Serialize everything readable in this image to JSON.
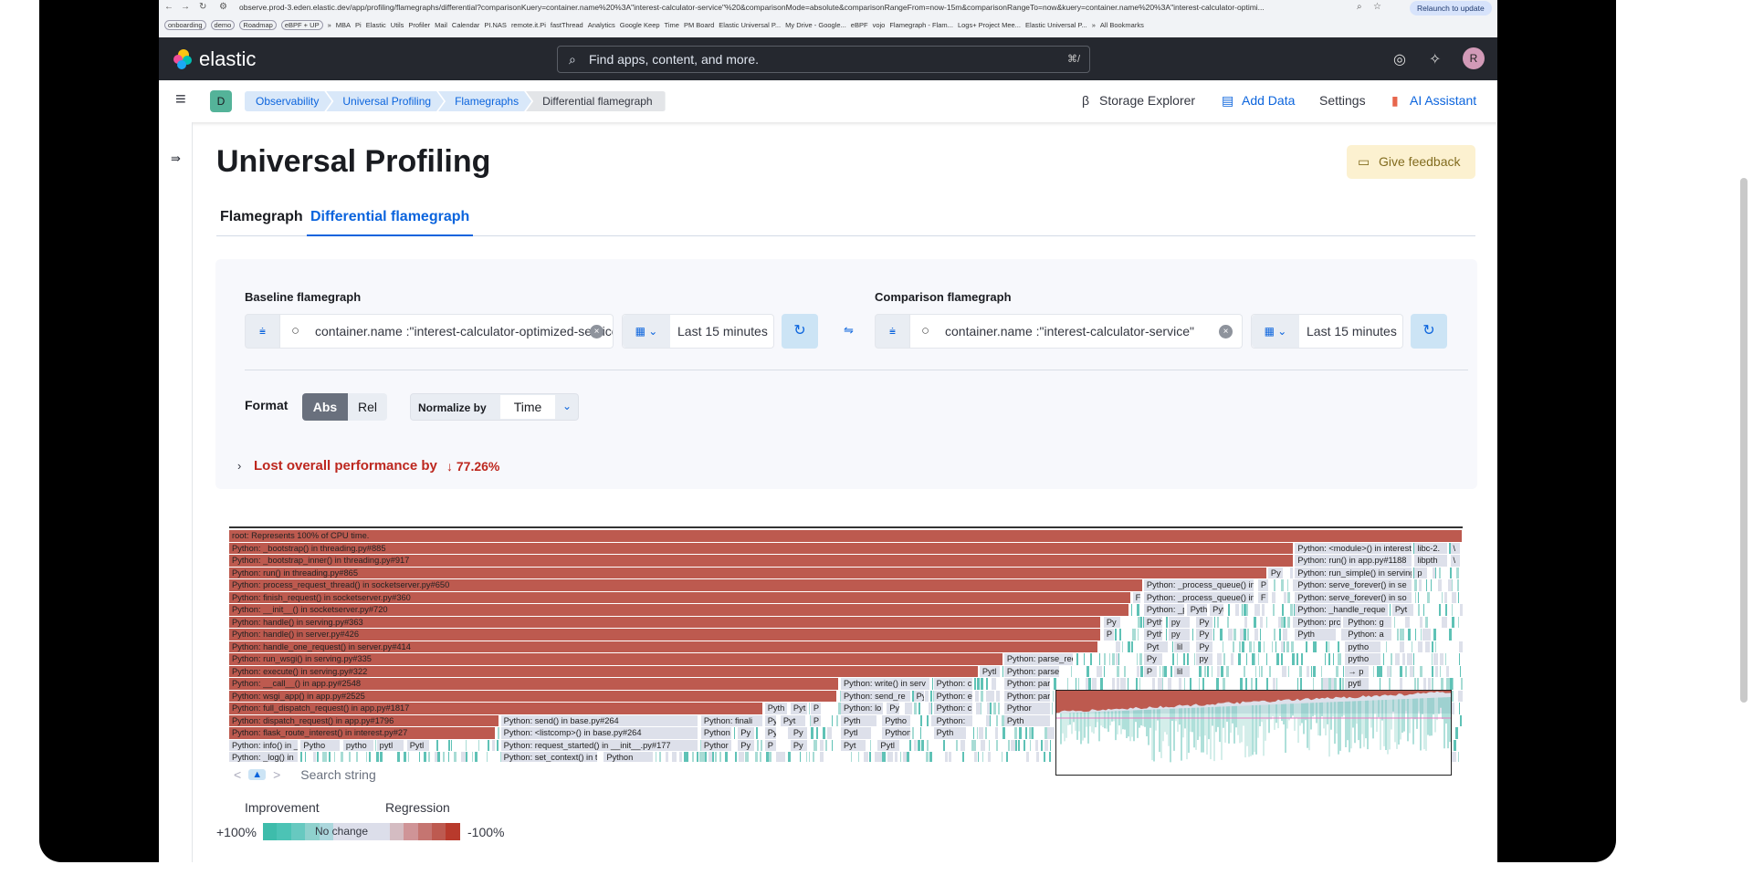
{
  "browser": {
    "url": "observe.prod-3.eden.elastic.dev/app/profiling/flamegraphs/differential?comparisonKuery=container.name%20%3A\"interest-calculator-service\"%20&comparisonMode=absolute&comparisonRangeFrom=now-15m&comparisonRangeTo=now&kuery=container.name%20%3A\"interest-calculator-optimi...",
    "relaunch": "Relaunch to update",
    "bookmarks": [
      "onboarding",
      "demo",
      "Roadmap",
      "eBPF + UP",
      "»",
      "MBA",
      "Pi",
      "Elastic",
      "Utils",
      "Profiler",
      "Mail",
      "Calendar",
      "PI.NAS",
      "remote.it.Pi",
      "fastThread",
      "Analytics",
      "Google Keep",
      "Time",
      "PM Board",
      "Elastic Universal P...",
      "My Drive - Google...",
      "eBPF",
      "vojo",
      "Flamegraph - Flam...",
      "Logs+ Project Mee...",
      "Elastic Universal P...",
      "»",
      "All Bookmarks"
    ]
  },
  "header": {
    "brand": "elastic",
    "search_placeholder": "Find apps, content, and more.",
    "shortcut": "⌘/",
    "avatar": "R"
  },
  "breadcrumbs": {
    "space": "D",
    "items": [
      "Observability",
      "Universal Profiling",
      "Flamegraphs",
      "Differential flamegraph"
    ]
  },
  "topnav": {
    "beta": "β",
    "storage": "Storage Explorer",
    "add_data": "Add Data",
    "settings": "Settings",
    "ai": "AI Assistant"
  },
  "page": {
    "title": "Universal Profiling",
    "feedback": "Give feedback",
    "tabs": [
      "Flamegraph",
      "Differential flamegraph"
    ],
    "active_tab": 1
  },
  "baseline": {
    "label": "Baseline flamegraph",
    "query": "container.name :\"interest-calculator-optimized-service\"",
    "time": "Last 15 minutes"
  },
  "comparison": {
    "label": "Comparison flamegraph",
    "query": "container.name :\"interest-calculator-service\"",
    "time": "Last 15 minutes"
  },
  "format": {
    "label": "Format",
    "options": [
      "Abs",
      "Rel"
    ],
    "selected": "Abs",
    "normalize_label": "Normalize by",
    "normalize_value": "Time"
  },
  "summary": {
    "text": "Lost overall performance by",
    "value": "↓ 77.26%",
    "color": "#bd271e"
  },
  "flamegraph": {
    "rows": [
      [
        {
          "l": "root: Represents 100% of CPU time.",
          "k": "r"
        }
      ],
      [
        {
          "l": "Python: _bootstrap() in threading.py#885",
          "k": "r"
        },
        {
          "l": "Python: <module>() in interest.py",
          "k": "n"
        },
        {
          "l": "libc-2.",
          "k": "n"
        },
        {
          "l": "\\",
          "k": "n"
        }
      ],
      [
        {
          "l": "Python: _bootstrap_inner() in threading.py#917",
          "k": "r"
        },
        {
          "l": "Python: run() in app.py#1188",
          "k": "n"
        },
        {
          "l": "libpth",
          "k": "n"
        },
        {
          "l": "\\",
          "k": "n"
        }
      ],
      [
        {
          "l": "Python: run() in threading.py#865",
          "k": "r"
        },
        {
          "l": "Py",
          "k": "n"
        },
        {
          "l": "Python: run_simple() in serving",
          "k": "n"
        },
        {
          "l": "p",
          "k": "n"
        }
      ],
      [
        {
          "l": "Python: process_request_thread() in socketserver.py#650",
          "k": "r"
        },
        {
          "l": "Python: _process_queue() in h",
          "k": "n"
        },
        {
          "l": "P",
          "k": "n"
        },
        {
          "l": "Python: serve_forever() in se",
          "k": "n"
        }
      ],
      [
        {
          "l": "Python: finish_request() in socketserver.py#360",
          "k": "r"
        },
        {
          "l": "F",
          "k": "n"
        },
        {
          "l": "Python: _process_queue() in t",
          "k": "n"
        },
        {
          "l": "F",
          "k": "n"
        },
        {
          "l": "Python: serve_forever() in so",
          "k": "n"
        }
      ],
      [
        {
          "l": "Python: __init__() in socketserver.py#720",
          "k": "r"
        },
        {
          "l": "Python: _pr",
          "k": "n"
        },
        {
          "l": "Pyth",
          "k": "n"
        },
        {
          "l": "Pyt",
          "k": "n"
        },
        {
          "l": "Python: _handle_reque",
          "k": "n"
        },
        {
          "l": "Pyt",
          "k": "n"
        }
      ],
      [
        {
          "l": "Python: handle() in serving.py#363",
          "k": "r"
        },
        {
          "l": "Py",
          "k": "n"
        },
        {
          "l": "Pytho",
          "k": "n"
        },
        {
          "l": "py",
          "k": "n"
        },
        {
          "l": "Py",
          "k": "n"
        },
        {
          "l": "Python: prc",
          "k": "n"
        },
        {
          "l": "Python: g",
          "k": "n"
        }
      ],
      [
        {
          "l": "Python: handle() in server.py#426",
          "k": "r"
        },
        {
          "l": "P",
          "k": "n"
        },
        {
          "l": "Pytho",
          "k": "n"
        },
        {
          "l": "py",
          "k": "n"
        },
        {
          "l": "Py",
          "k": "n"
        },
        {
          "l": "Pyth",
          "k": "n"
        },
        {
          "l": "Python: a",
          "k": "n"
        }
      ],
      [
        {
          "l": "Python: handle_one_request() in server.py#414",
          "k": "r"
        },
        {
          "l": "Pyt",
          "k": "n"
        },
        {
          "l": "lil",
          "k": "n"
        },
        {
          "l": "Py",
          "k": "n"
        },
        {
          "l": "pytho",
          "k": "n"
        }
      ],
      [
        {
          "l": "Python: run_wsgi() in serving.py#335",
          "k": "r"
        },
        {
          "l": "Python: parse_rec",
          "k": "n"
        },
        {
          "l": "Py",
          "k": "n"
        },
        {
          "l": "py",
          "k": "n"
        },
        {
          "l": "pytho",
          "k": "n"
        }
      ],
      [
        {
          "l": "Python: execute() in serving.py#322",
          "k": "r"
        },
        {
          "l": "Pytl",
          "k": "n"
        },
        {
          "l": "Python: parse",
          "k": "n"
        },
        {
          "l": "P",
          "k": "n"
        },
        {
          "l": "lil",
          "k": "n"
        },
        {
          "l": "→ p",
          "k": "n"
        }
      ],
      [
        {
          "l": "Python: __call__() in app.py#2548",
          "k": "r"
        },
        {
          "l": "Python: write() in serv",
          "k": "n"
        },
        {
          "l": "Python: c",
          "k": "n"
        },
        {
          "l": "Python: par",
          "k": "n"
        },
        {
          "l": "pytl",
          "k": "n"
        }
      ],
      [
        {
          "l": "Python: wsgi_app() in app.py#2525",
          "k": "r"
        },
        {
          "l": "Python: send_re",
          "k": "n"
        },
        {
          "l": "Py",
          "k": "n"
        },
        {
          "l": "Python: e",
          "k": "n"
        },
        {
          "l": "Python: par",
          "k": "n"
        }
      ],
      [
        {
          "l": "Python: full_dispatch_request() in app.py#1817",
          "k": "r"
        },
        {
          "l": "Pyth",
          "k": "n"
        },
        {
          "l": "Pyt",
          "k": "n"
        },
        {
          "l": "P",
          "k": "n"
        },
        {
          "l": "Python: lo",
          "k": "n"
        },
        {
          "l": "Py",
          "k": "n"
        },
        {
          "l": "Python: c",
          "k": "n"
        },
        {
          "l": "Pythor",
          "k": "n"
        }
      ],
      [
        {
          "l": "Python: dispatch_request() in app.py#1796",
          "k": "r"
        },
        {
          "l": "Python: send() in base.py#264",
          "k": "n"
        },
        {
          "l": "Python: finali",
          "k": "n"
        },
        {
          "l": "Py",
          "k": "n"
        },
        {
          "l": "Pyt",
          "k": "n"
        },
        {
          "l": "P",
          "k": "n"
        },
        {
          "l": "Pyth",
          "k": "n"
        },
        {
          "l": "Pytho",
          "k": "n"
        },
        {
          "l": "Python:",
          "k": "n"
        },
        {
          "l": "Pyth",
          "k": "n"
        }
      ],
      [
        {
          "l": "Python: flask_route_interest() in interest.py#27",
          "k": "r"
        },
        {
          "l": "Python: <listcomp>() in base.py#264",
          "k": "n"
        },
        {
          "l": "Python",
          "k": "n"
        },
        {
          "l": "Py",
          "k": "n"
        },
        {
          "l": "Py",
          "k": "n"
        },
        {
          "l": "Py",
          "k": "n"
        },
        {
          "l": "Pytl",
          "k": "n"
        },
        {
          "l": "Python",
          "k": "n"
        },
        {
          "l": "Pyth",
          "k": "n"
        }
      ],
      [
        {
          "l": "Python: info() in _",
          "k": "n"
        },
        {
          "l": "Pytho",
          "k": "n"
        },
        {
          "l": "pytho",
          "k": "n"
        },
        {
          "l": "pytl",
          "k": "n"
        },
        {
          "l": "Pytl",
          "k": "n"
        },
        {
          "l": "Python: request_started() in __init__.py#177",
          "k": "n"
        },
        {
          "l": "Pythor",
          "k": "n"
        },
        {
          "l": "Py",
          "k": "n"
        },
        {
          "l": "P",
          "k": "n"
        },
        {
          "l": "Py",
          "k": "n"
        },
        {
          "l": "Pyt",
          "k": "n"
        },
        {
          "l": "Pytl",
          "k": "n"
        }
      ],
      [
        {
          "l": "Python: _log() in",
          "k": "n"
        },
        {
          "l": "Python: set_context() in trac",
          "k": "n"
        },
        {
          "l": "Python",
          "k": "n"
        }
      ]
    ],
    "search_placeholder": "Search string",
    "regression_color": "#bd5a4f",
    "improvement_color": "#5fc2b6",
    "neutral_color": "#dde0ea"
  },
  "legend": {
    "improvement": "Improvement",
    "regression": "Regression",
    "plus": "+100%",
    "minus": "-100%",
    "no_change": "No change",
    "colors": [
      "#3ebcab",
      "#4cc3b5",
      "#67c9c0",
      "#8fd1cd",
      "#acd7dd",
      "#dcdeea",
      "#dcdeea",
      "#dcdeea",
      "#dcdeea",
      "#d4bcc2",
      "#cf9497",
      "#c57571",
      "#bd5a50",
      "#b83a2c"
    ]
  }
}
